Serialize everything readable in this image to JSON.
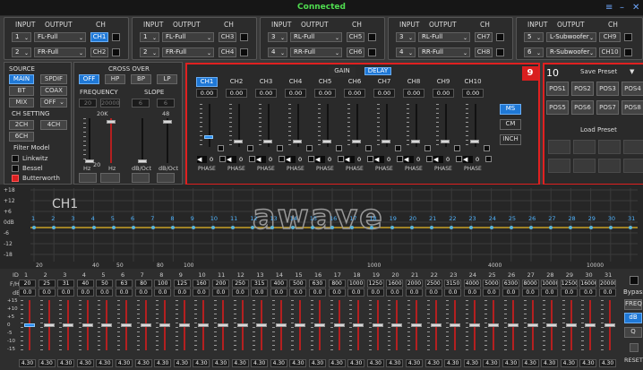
{
  "title": "Connected",
  "window": {
    "min": "–",
    "close": "✕",
    "menu": "≡"
  },
  "routing": {
    "hdr_input": "INPUT",
    "hdr_output": "OUTPUT",
    "hdr_ch": "CH",
    "groups": [
      {
        "rows": [
          {
            "in": "1",
            "out": "FL-Full",
            "ch": "CH1",
            "active": true
          },
          {
            "in": "2",
            "out": "FR-Full",
            "ch": "CH2",
            "active": false
          }
        ]
      },
      {
        "rows": [
          {
            "in": "1",
            "out": "FL-Full",
            "ch": "CH3",
            "active": false
          },
          {
            "in": "2",
            "out": "FR-Full",
            "ch": "CH4",
            "active": false
          }
        ]
      },
      {
        "rows": [
          {
            "in": "3",
            "out": "RL-Full",
            "ch": "CH5",
            "active": false
          },
          {
            "in": "4",
            "out": "RR-Full",
            "ch": "CH6",
            "active": false
          }
        ]
      },
      {
        "rows": [
          {
            "in": "3",
            "out": "RL-Full",
            "ch": "CH7",
            "active": false
          },
          {
            "in": "4",
            "out": "RR-Full",
            "ch": "CH8",
            "active": false
          }
        ]
      },
      {
        "rows": [
          {
            "in": "5",
            "out": "L-Subwoofer",
            "ch": "CH9",
            "active": false
          },
          {
            "in": "6",
            "out": "R-Subwoofer",
            "ch": "CH10",
            "active": false
          }
        ]
      }
    ]
  },
  "source": {
    "title": "SOURCE",
    "main": "MAIN",
    "spdif": "SPDIF",
    "bt": "BT",
    "coax": "COAX",
    "mix": "MIX",
    "off": "OFF"
  },
  "ch_setting": {
    "title": "CH SETTING",
    "c2": "2CH",
    "c4": "4CH",
    "c6": "6CH"
  },
  "filter": {
    "title": "Filter Model",
    "items": [
      "Linkwitz",
      "Bessel",
      "Butterworth"
    ],
    "active": 2
  },
  "crossover": {
    "title": "CROSS OVER",
    "modes": [
      "OFF",
      "HP",
      "BP",
      "LP"
    ],
    "active_mode": 0,
    "freq": "FREQUENCY",
    "slope": "SLOPE",
    "f1": "20",
    "f2": "20000",
    "s1": "6",
    "s2": "6",
    "v1": "20K",
    "v2": "48",
    "lo": "20",
    "hz1": "Hz",
    "hz2": "Hz",
    "db1": "dB/Oct",
    "db2": "dB/Oct"
  },
  "mixer": {
    "badge": "9",
    "gain": "GAIN",
    "delay": "DELAY",
    "channels": [
      {
        "name": "CH1",
        "val": "0.00",
        "level": 0.1,
        "sel": true
      },
      {
        "name": "CH2",
        "val": "0.00",
        "level": 0.0
      },
      {
        "name": "CH3",
        "val": "0.00",
        "level": 0.0
      },
      {
        "name": "CH4",
        "val": "0.00",
        "level": 0.0
      },
      {
        "name": "CH5",
        "val": "0.00",
        "level": 0.0
      },
      {
        "name": "CH6",
        "val": "0.00",
        "level": 0.0
      },
      {
        "name": "CH7",
        "val": "0.00",
        "level": 0.0
      },
      {
        "name": "CH8",
        "val": "0.00",
        "level": 0.0
      },
      {
        "name": "CH9",
        "val": "0.00",
        "level": 0.0
      },
      {
        "name": "CH10",
        "val": "0.00",
        "level": 0.0
      }
    ],
    "vol": "0",
    "phase": "PHASE",
    "units": {
      "ms": "MS",
      "cm": "CM",
      "inch": "INCH"
    }
  },
  "preset": {
    "badge": "10",
    "save": "Save Preset",
    "load": "Load Preset",
    "pos": [
      "POS1",
      "POS2",
      "POS3",
      "POS4",
      "POS5",
      "POS6",
      "POS7",
      "POS8"
    ]
  },
  "graph": {
    "ch": "CH1",
    "logo": "awave",
    "y": [
      "+18",
      "+12",
      "+6",
      "0dB",
      "-6",
      "-12",
      "-18"
    ],
    "x": [
      "20",
      "40",
      "50",
      "80",
      "100",
      "1000",
      "4000",
      "10000"
    ],
    "band_nums": [
      "1",
      "2",
      "3",
      "4",
      "5",
      "6",
      "7",
      "8",
      "9",
      "10",
      "11",
      "12",
      "13",
      "14",
      "15",
      "16",
      "17",
      "18",
      "19",
      "20",
      "21",
      "22",
      "23",
      "24",
      "25",
      "26",
      "27",
      "28",
      "29",
      "30",
      "31"
    ]
  },
  "eq": {
    "id": "ID",
    "fhz": "F/Hz",
    "db": "dB",
    "q": "Q",
    "ids": [
      "1",
      "2",
      "3",
      "4",
      "5",
      "6",
      "7",
      "8",
      "9",
      "10",
      "11",
      "12",
      "13",
      "14",
      "15",
      "16",
      "17",
      "18",
      "19",
      "20",
      "21",
      "22",
      "23",
      "24",
      "25",
      "26",
      "27",
      "28",
      "29",
      "30",
      "31"
    ],
    "freqs": [
      "20",
      "25",
      "31",
      "40",
      "50",
      "63",
      "80",
      "100",
      "125",
      "160",
      "200",
      "250",
      "315",
      "400",
      "500",
      "630",
      "800",
      "1000",
      "1250",
      "1600",
      "2000",
      "2500",
      "3150",
      "4000",
      "5000",
      "6300",
      "8000",
      "10000",
      "12500",
      "16000",
      "20000"
    ],
    "dbs": [
      "0.0",
      "0.0",
      "0.0",
      "0.0",
      "0.0",
      "0.0",
      "0.0",
      "0.0",
      "0.0",
      "0.0",
      "0.0",
      "0.0",
      "0.0",
      "0.0",
      "0.0",
      "0.0",
      "0.0",
      "0.0",
      "0.0",
      "0.0",
      "0.0",
      "0.0",
      "0.0",
      "0.0",
      "0.0",
      "0.0",
      "0.0",
      "0.0",
      "0.0",
      "0.0",
      "0.0"
    ],
    "qs": [
      "4.30",
      "4.30",
      "4.30",
      "4.30",
      "4.30",
      "4.30",
      "4.30",
      "4.30",
      "4.30",
      "4.30",
      "4.30",
      "4.30",
      "4.30",
      "4.30",
      "4.30",
      "4.30",
      "4.30",
      "4.30",
      "4.30",
      "4.30",
      "4.30",
      "4.30",
      "4.30",
      "4.30",
      "4.30",
      "4.30",
      "4.30",
      "4.30",
      "4.30",
      "4.30",
      "4.30"
    ],
    "scale": [
      "+15",
      "+10",
      "+5",
      "0",
      "-5",
      "-10",
      "-15"
    ],
    "bypass": "Bypass",
    "freq_btn": "FREQ",
    "db_btn": "dB",
    "q_btn": "Q",
    "reset": "RESET"
  }
}
